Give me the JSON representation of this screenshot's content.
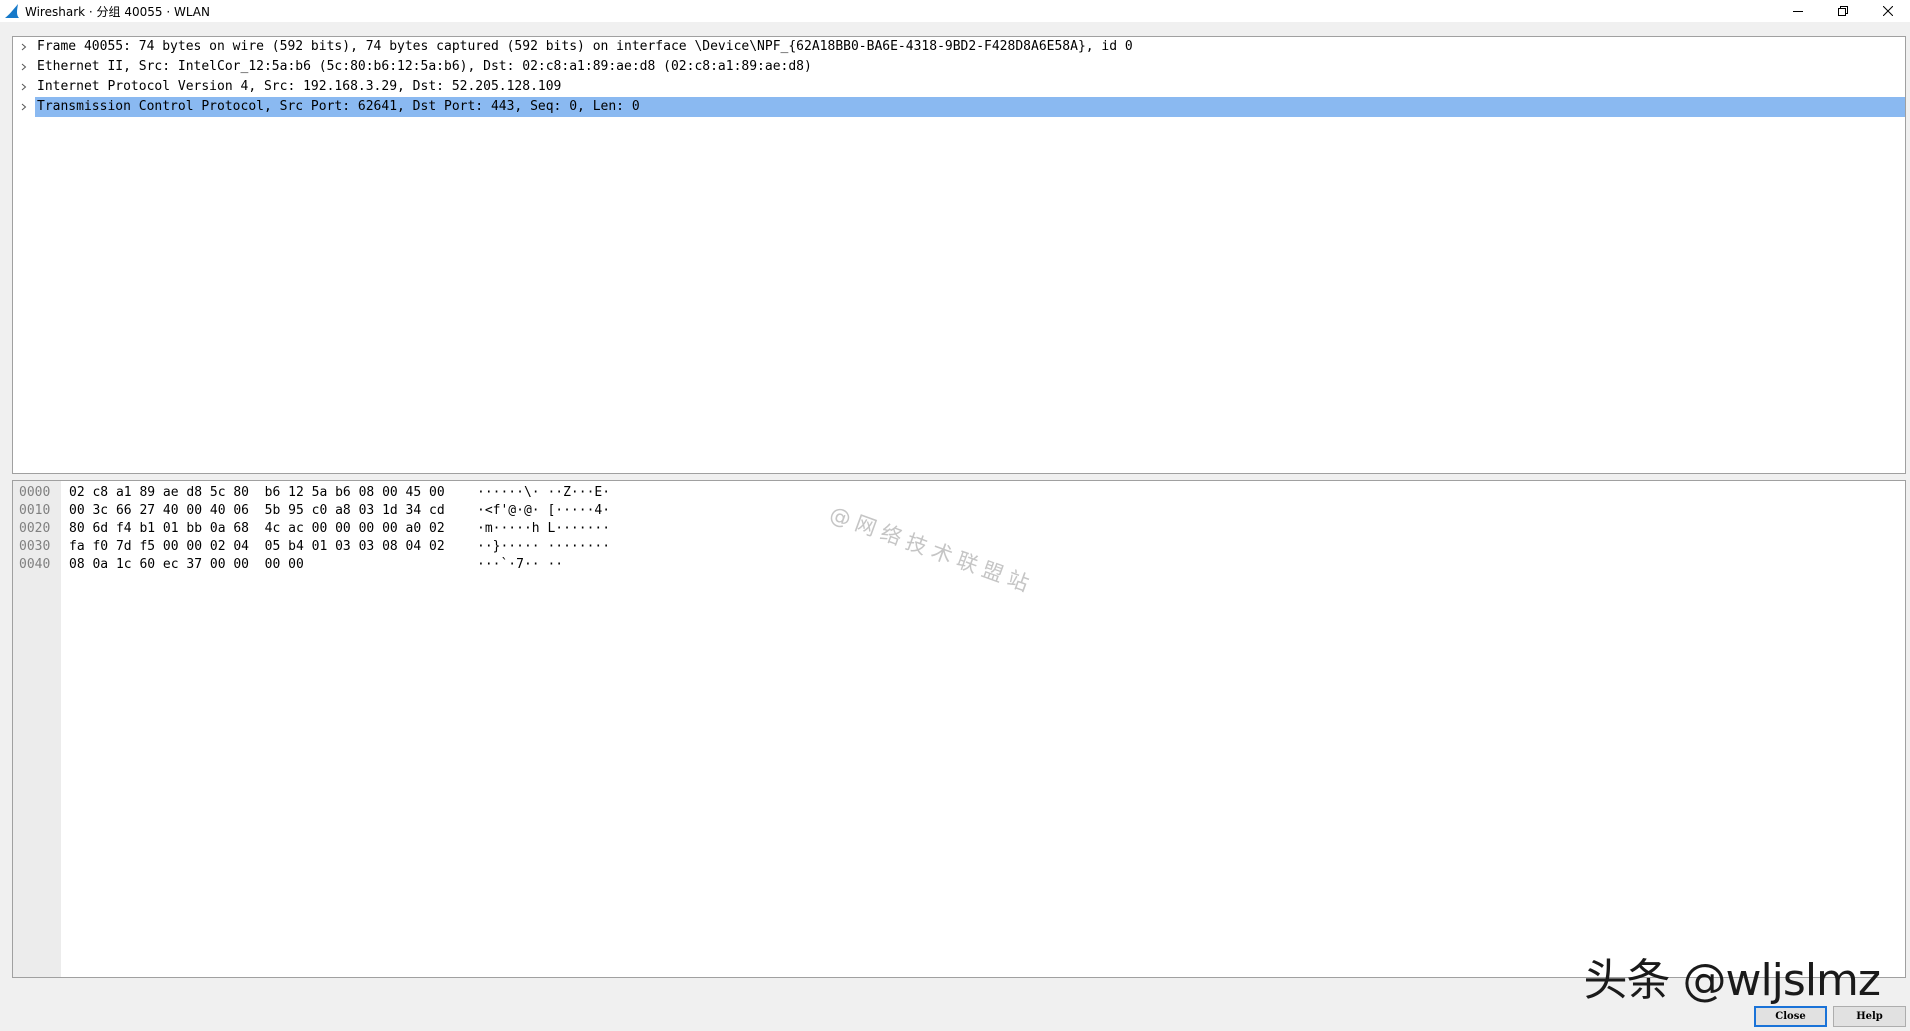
{
  "window": {
    "title": "Wireshark · 分组 40055 · WLAN",
    "app_icon": "wireshark-fin-icon",
    "controls": [
      "minimize-icon",
      "restore-icon",
      "close-icon"
    ]
  },
  "tree": {
    "rows": [
      {
        "text": "Frame 40055: 74 bytes on wire (592 bits), 74 bytes captured (592 bits) on interface \\Device\\NPF_{62A18BB0-BA6E-4318-9BD2-F428D8A6E58A}, id 0",
        "selected": false
      },
      {
        "text": "Ethernet II, Src: IntelCor_12:5a:b6 (5c:80:b6:12:5a:b6), Dst: 02:c8:a1:89:ae:d8 (02:c8:a1:89:ae:d8)",
        "selected": false
      },
      {
        "text": "Internet Protocol Version 4, Src: 192.168.3.29, Dst: 52.205.128.109",
        "selected": false
      },
      {
        "text": "Transmission Control Protocol, Src Port: 62641, Dst Port: 443, Seq: 0, Len: 0",
        "selected": true
      }
    ],
    "selected_color": "#8ab9f1"
  },
  "bytes": {
    "rows": [
      {
        "offset": "0000",
        "hex": "02 c8 a1 89 ae d8 5c 80  b6 12 5a b6 08 00 45 00",
        "ascii": "······\\· ··Z···E·"
      },
      {
        "offset": "0010",
        "hex": "00 3c 66 27 40 00 40 06  5b 95 c0 a8 03 1d 34 cd",
        "ascii": "·<f'@·@· [·····4·"
      },
      {
        "offset": "0020",
        "hex": "80 6d f4 b1 01 bb 0a 68  4c ac 00 00 00 00 a0 02",
        "ascii": "·m·····h L·······"
      },
      {
        "offset": "0030",
        "hex": "fa f0 7d f5 00 00 02 04  05 b4 01 03 03 08 04 02",
        "ascii": "··}····· ········"
      },
      {
        "offset": "0040",
        "hex": "08 0a 1c 60 ec 37 00 00  00 00",
        "ascii": "···`·7·· ··"
      }
    ]
  },
  "watermarks": {
    "diagonal": "@网络技术联盟站",
    "corner": "头条 @wljslmz"
  },
  "buttons": {
    "close_label": "Close",
    "help_label": "Help"
  }
}
